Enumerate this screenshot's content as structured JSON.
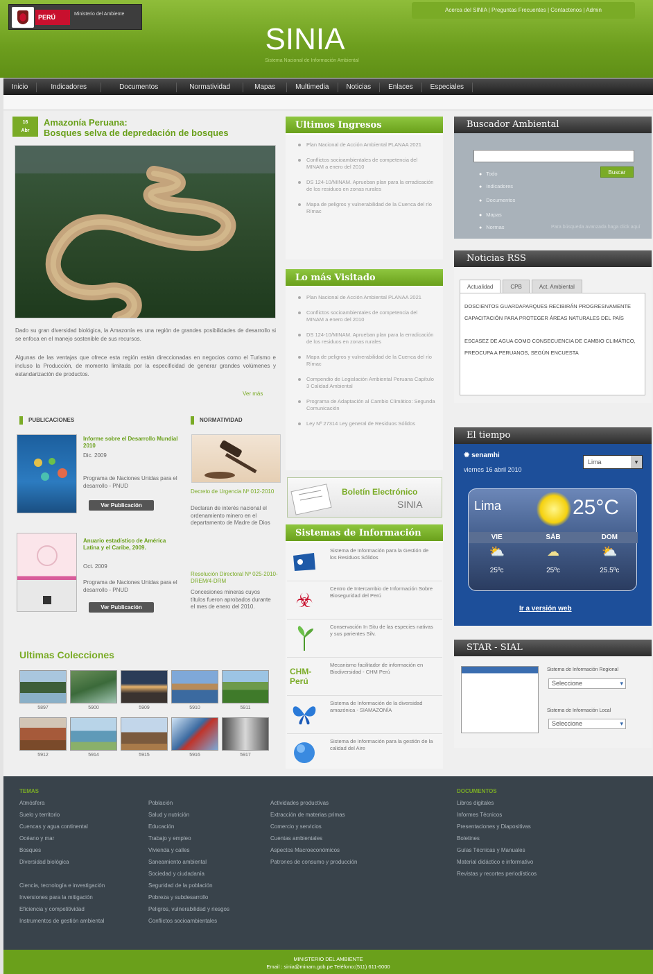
{
  "header": {
    "logo_country": "PERÚ",
    "logo_ministry": "Ministerio del Ambiente",
    "top_links": "Acerca del SINIA | Preguntas Frecuentes | Contactenos | Admin",
    "title": "SINIA",
    "subtitle": "Sistema Nacional de Información Ambiental"
  },
  "nav": [
    "Inicio",
    "Indicadores",
    "Documentos",
    "Normatividad",
    "Mapas",
    "Multimedia",
    "Noticias",
    "Enlaces",
    "Especiales"
  ],
  "feature": {
    "date_day": "16",
    "date_month": "Abr",
    "headline_line1": "Amazonía Peruana:",
    "headline_line2": "Bosques selva de depredación de bosques",
    "intro1": "Dado su gran diversidad biológica, la Amazonía es una región de grandes posibilidades de desarrollo si se enfoca en el manejo sostenible de sus recursos.",
    "intro2": "Algunas de las ventajas que ofrece esta región están direccionadas en negocios como el Turismo e incluso la Producción, de momento limitada por la especificidad de generar grandes volúmenes y estandarización de productos.",
    "more": "Ver más"
  },
  "publicaciones": {
    "label": "PUBLICACIONES",
    "items": [
      {
        "title": "Informe sobre el Desarrollo Mundial 2010",
        "date": "Dic. 2009",
        "org": "Programa de Naciones Unidas para el desarrollo - PNUD",
        "button": "Ver Publicación"
      },
      {
        "title": "Anuario estadístico de América Latina y el Caribe, 2009.",
        "date": "Oct. 2009",
        "org": "Programa de Naciones Unidas para el desarrollo - PNUD",
        "button": "Ver Publicación"
      }
    ]
  },
  "normatividad": {
    "label": "NORMATIVIDAD",
    "items": [
      {
        "link": "Decreto de Urgencia Nº 012-2010",
        "desc": "Declaran de interés nacional el ordenamiento minero en el departamento de Madre de Dios"
      },
      {
        "link": "Resolución Directoral Nº 025-2010-DREM/4-DRM",
        "desc": "Concesiones mineras cuyos títulos fueron aprobados durante el mes de enero del 2010."
      }
    ]
  },
  "colecciones": {
    "title": "Ultimas Colecciones",
    "items": [
      "5897",
      "5900",
      "5909",
      "5910",
      "5911",
      "5912",
      "5914",
      "5915",
      "5916",
      "5917"
    ]
  },
  "ultimos_ingresos": {
    "title": "Ultimos Ingresos",
    "items": [
      "Plan Nacional de Acción Ambiental PLANAA 2021",
      "Conflictos socioambientales de competencia del MINAM a enero del 2010",
      "DS 124-10/MINAM. Aprueban plan para la erradicación de los residuos en zonas rurales",
      "Mapa de peligros y vulnerabilidad de la Cuenca del río Rímac"
    ]
  },
  "mas_visitado": {
    "title": "Lo más Visitado",
    "items": [
      "Plan Nacional de Acción Ambiental PLANAA 2021",
      "Conflictos socioambientales de competencia del MINAM a enero del 2010",
      "DS 124-10/MINAM. Aprueban plan para la erradicación de los residuos en zonas rurales",
      "Mapa de peligros y vulnerabilidad de la Cuenca del río Rímac",
      "Compendio de Legislación Ambiental Peruana Capítulo 3 Calidad Ambiental",
      "Programa de Adaptación al Cambio Climático: Segunda Comunicación",
      "Ley Nº 27314 Ley general de Residuos Sólidos"
    ]
  },
  "boletin": {
    "line1": "Boletín Electrónico",
    "line2": "SINIA"
  },
  "sistemas": {
    "title": "Sistemas de Información",
    "items": [
      {
        "icon": "recycle-bin-icon",
        "text": "Sistema de Información para la Gestión de los Residuos Sólidos"
      },
      {
        "icon": "biohazard-icon",
        "text": "Centro de Intercambio de Información Sobre Bioseguridad del Perú"
      },
      {
        "icon": "plant-icon",
        "text": "Conservación In Situ de las especies nativas y sus parientes Silv."
      },
      {
        "icon": "chm-peru-icon",
        "text": "Mecanismo facilitador de información en Biodiversidad - CHM Perú"
      },
      {
        "icon": "butterfly-icon",
        "text": "Sistema de Información de la diversidad amazónica - SIAMAZONÍA"
      },
      {
        "icon": "globe-icon",
        "text": "Sistema de Información para la gestión de la calidad del Aire"
      }
    ]
  },
  "buscador": {
    "title": "Buscador Ambiental",
    "button": "Buscar",
    "options": [
      "Todo",
      "Indicadores",
      "Documentos",
      "Mapas",
      "Normas"
    ],
    "advanced": "Para búsqueda avanzada haga click aquí"
  },
  "rss": {
    "title": "Noticias RSS",
    "tabs": [
      "Actualidad",
      "CPB",
      "Act. Ambiental"
    ],
    "news": [
      "Doscientos guardaparques recibirán progresivamente capacitación para proteger áreas naturales del país",
      "Escasez de agua como consecuencia de cambio climático, preocupa a peruanos, según encuesta"
    ]
  },
  "tiempo": {
    "title": "El tiempo",
    "provider": "senamhi",
    "date": "viernes 16 abril 2010",
    "city_select": "Lima",
    "city": "Lima",
    "temperature": "25°C",
    "days": [
      "VIE",
      "SÁB",
      "DOM"
    ],
    "temps": [
      "25ºc",
      "25ºc",
      "25.5ºc"
    ],
    "link": "Ir a versión web"
  },
  "star": {
    "title": "STAR - SIAL",
    "label_regional": "Sistema de Información Regional",
    "label_local": "Sistema de Información Local",
    "select_regional": "Seleccione",
    "select_local": "Seleccione"
  },
  "footer": {
    "col1": {
      "head": "TEMAS",
      "items": [
        "Atmósfera",
        "Suelo y territorio",
        "Cuencas y agua continental",
        "Océano y mar",
        "Bosques",
        "Diversidad biológica",
        "",
        "Ciencia, tecnología e investigación",
        "Inversiones para la mitigación",
        "Eficiencia y competitividad",
        "Instrumentos de gestión ambiental"
      ]
    },
    "col2": {
      "items": [
        "Población",
        "Salud y nutrición",
        "Educación",
        "Trabajo y empleo",
        "Vivienda y calles",
        "Saneamiento ambiental",
        "Sociedad y ciudadanía",
        "Seguridad de la población",
        "Pobreza y subdesarrollo",
        "Peligros, vulnerabilidad y riesgos",
        "Conflictos socioambientales"
      ]
    },
    "col3": {
      "items": [
        "Actividades productivas",
        "Extracción de materias primas",
        "Comercio y servicios",
        "Cuentas ambientales",
        "Aspectos Macroeconómicos",
        "Patrones de consumo y producción"
      ]
    },
    "col4": {
      "head": "DOCUMENTOS",
      "items": [
        "Libros digitales",
        "Informes Técnicos",
        "Presentaciones y Diapositivas",
        "Boletines",
        "Guías Técnicas y Manuales",
        "Material didáctico e informativo",
        "Revistas y recortes periodísticos"
      ]
    },
    "bottom_line1": "MINISTERIO DEL AMBIENTE",
    "bottom_line2": "Email : sinia@minam.gob.pe Teléfono:(511) 611-6000"
  }
}
